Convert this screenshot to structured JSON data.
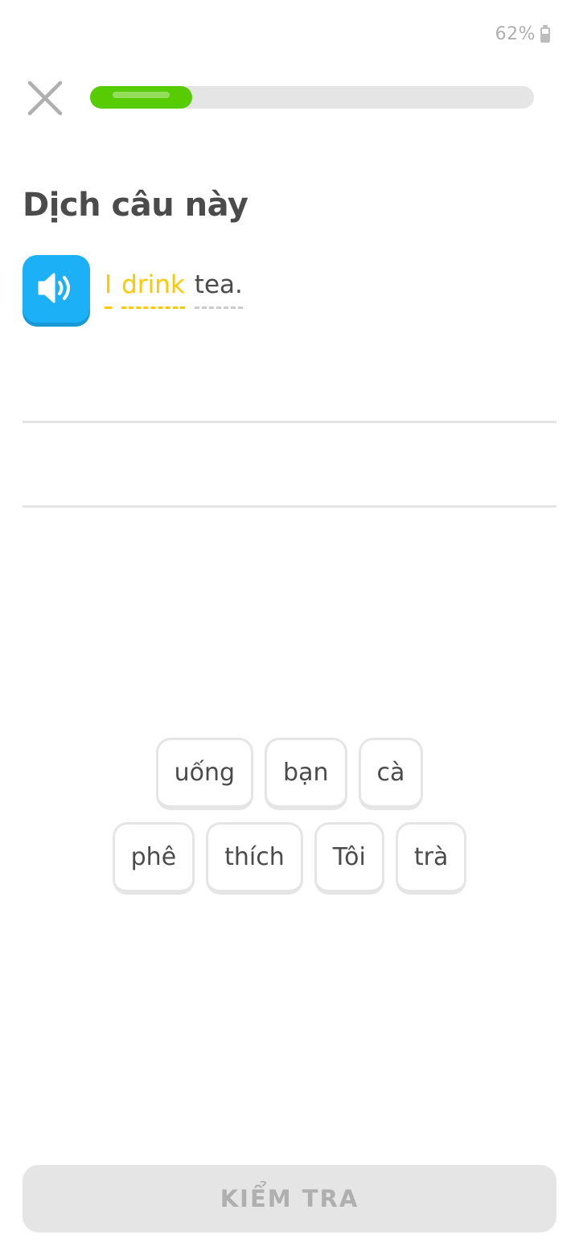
{
  "status_bar": {
    "battery_text": "62%",
    "battery_level": 0.62,
    "battery_icon": "battery-icon"
  },
  "header": {
    "close_icon": "close-icon",
    "progress": 0.23,
    "progress_color": "#58cc02"
  },
  "exercise": {
    "title": "Dịch câu này",
    "speaker_icon": "speaker-icon",
    "speaker_color": "#1cb0f6",
    "prompt_words": [
      {
        "text": "I",
        "highlighted": true
      },
      {
        "text": "drink",
        "highlighted": true
      },
      {
        "text": "tea.",
        "highlighted": false
      }
    ],
    "highlight_color": "#ffc800"
  },
  "word_bank": {
    "rows": [
      [
        "uống",
        "bạn",
        "cà"
      ],
      [
        "phê",
        "thích",
        "Tôi",
        "trà"
      ]
    ]
  },
  "footer": {
    "check_label": "KIỂM TRA"
  }
}
